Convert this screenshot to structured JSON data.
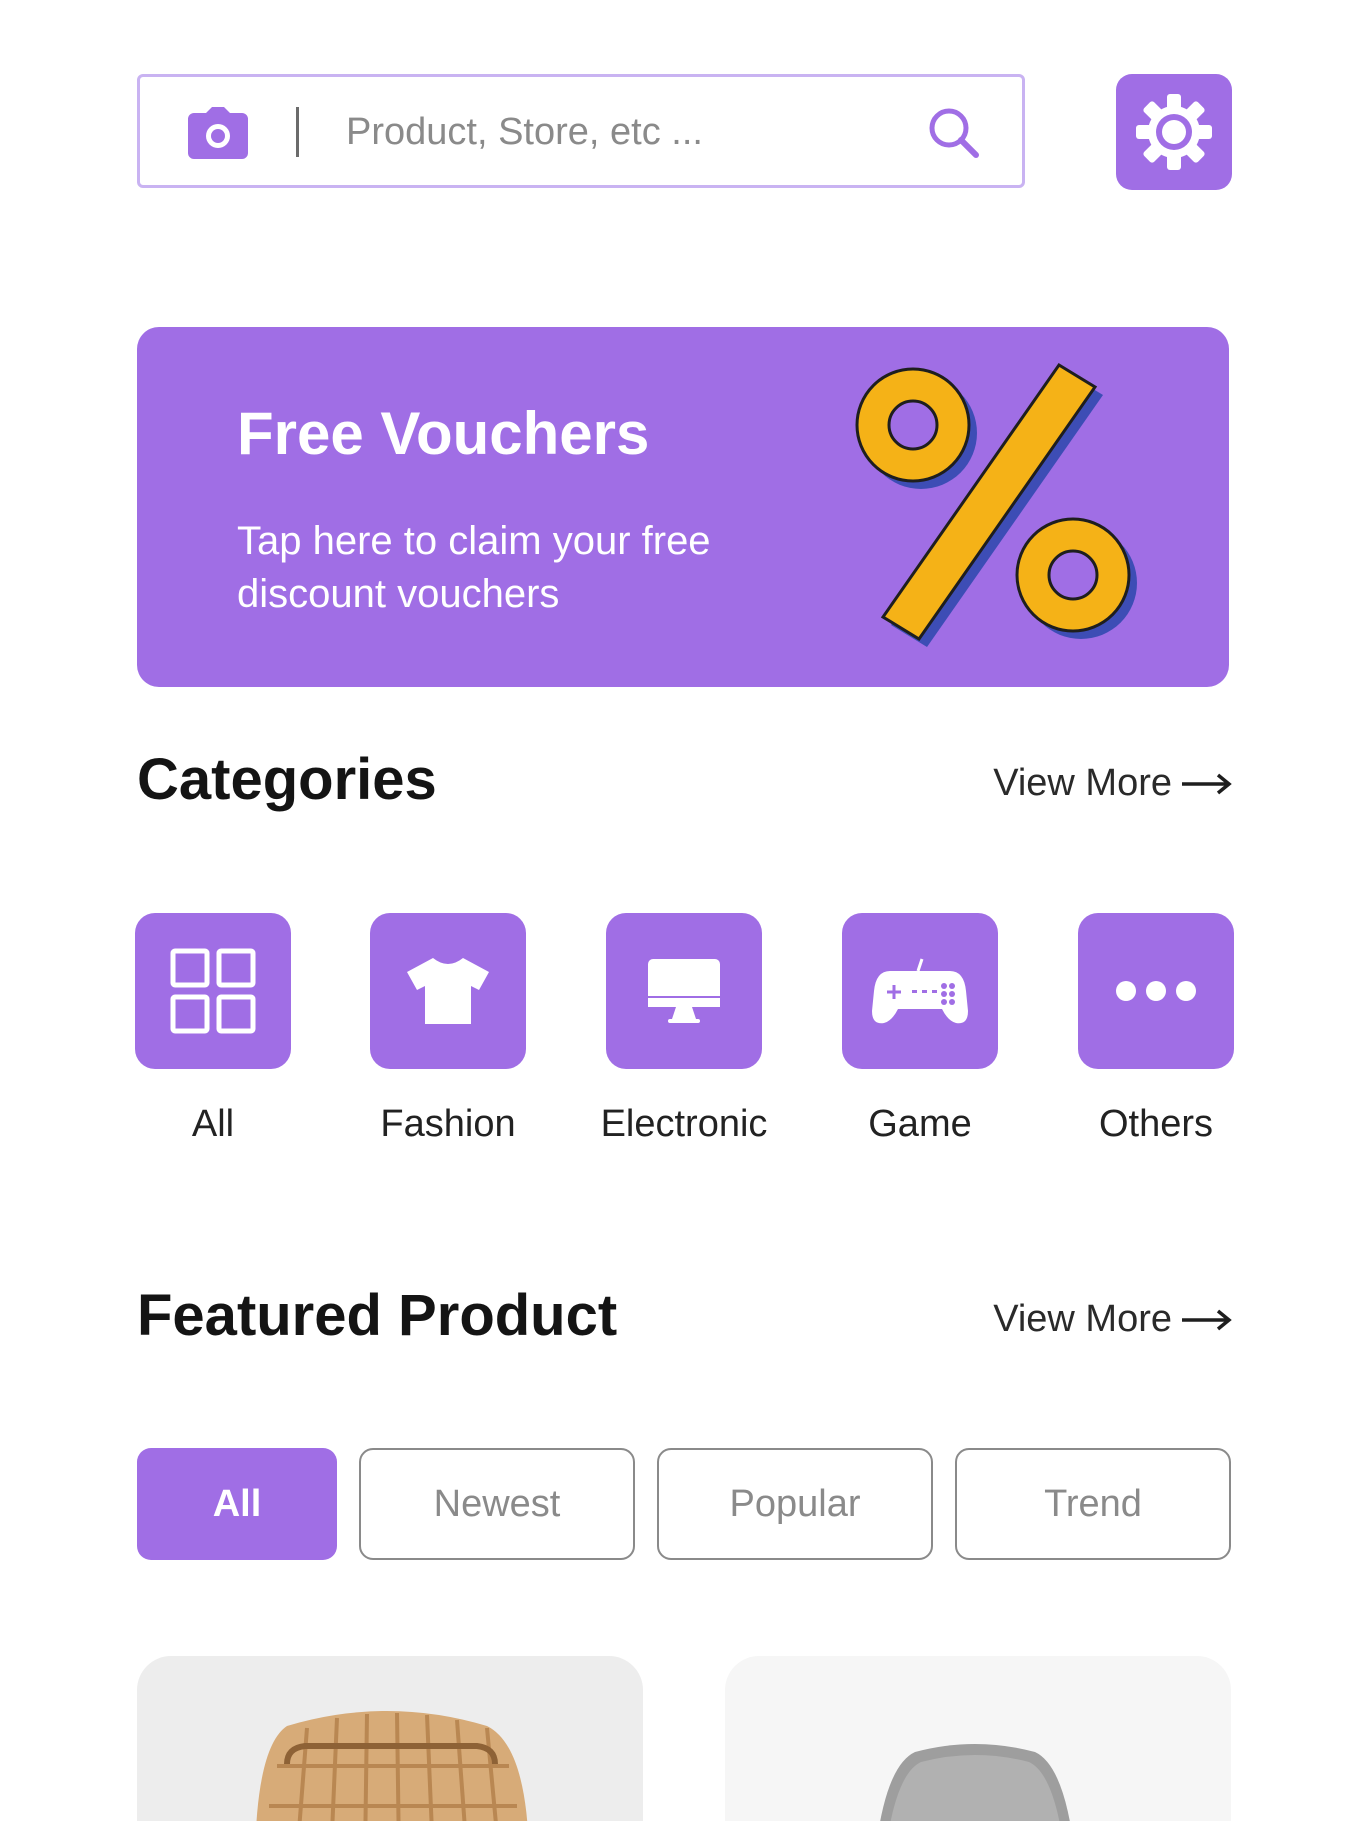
{
  "search": {
    "placeholder": "Product, Store, etc ..."
  },
  "banner": {
    "title": "Free Vouchers",
    "subtitle": "Tap here to claim your free discount vouchers"
  },
  "categories": {
    "title": "Categories",
    "view_more": "View More",
    "items": [
      {
        "label": "All",
        "icon": "grid-icon"
      },
      {
        "label": "Fashion",
        "icon": "tshirt-icon"
      },
      {
        "label": "Electronic",
        "icon": "monitor-icon"
      },
      {
        "label": "Game",
        "icon": "gamepad-icon"
      },
      {
        "label": "Others",
        "icon": "more-dots-icon"
      }
    ]
  },
  "featured": {
    "title": "Featured Product",
    "view_more": "View More",
    "filters": [
      {
        "label": "All",
        "active": true
      },
      {
        "label": "Newest",
        "active": false
      },
      {
        "label": "Popular",
        "active": false
      },
      {
        "label": "Trend",
        "active": false
      }
    ]
  },
  "colors": {
    "accent": "#a06ee5",
    "accent_border": "#c9b3f2",
    "voucher_yellow": "#f5b217",
    "voucher_shadow": "#3d4db5"
  }
}
